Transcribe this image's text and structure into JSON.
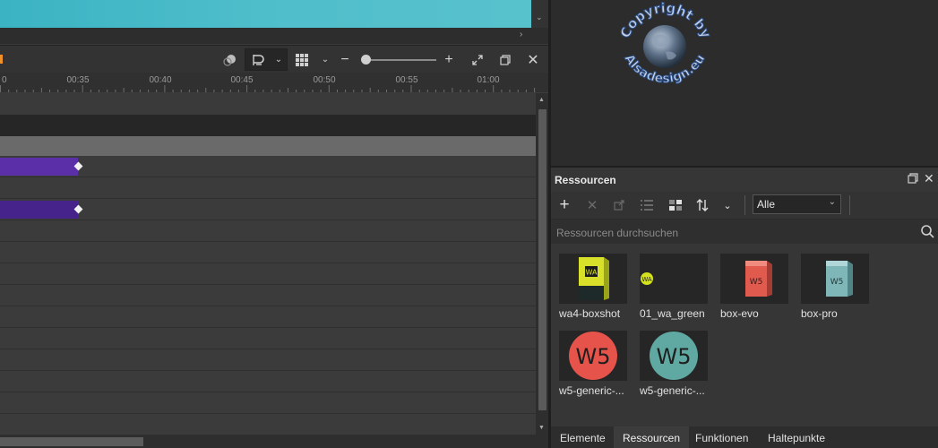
{
  "timeline": {
    "ruler_labels": [
      "0",
      "00:35",
      "00:40",
      "00:45",
      "00:50",
      "00:55",
      "01:00"
    ],
    "clip_color_1": "#5a2fa8",
    "clip_color_2": "#46238a",
    "accent_color": "#f0902a"
  },
  "watermark": {
    "line1": "Copyright by",
    "line2": "Alsadesign.eu"
  },
  "resources": {
    "title": "Ressourcen",
    "filter_value": "Alle",
    "search_placeholder": "Ressourcen durchsuchen",
    "items": [
      {
        "label": "wa4-boxshot",
        "icon": "wa4-boxshot-image"
      },
      {
        "label": "01_wa_green",
        "icon": "wa-green-logo-image"
      },
      {
        "label": "box-evo",
        "icon": "box-evo-image"
      },
      {
        "label": "box-pro",
        "icon": "box-pro-image"
      },
      {
        "label": "w5-generic-...",
        "icon": "w5-red-logo-image"
      },
      {
        "label": "w5-generic-...",
        "icon": "w5-teal-logo-image"
      }
    ]
  },
  "bottom_tabs": {
    "elemente": "Elemente",
    "ressourcen": "Ressourcen",
    "funktionen": "Funktionen",
    "haltepunkte": "Haltepunkte",
    "active": "Ressourcen"
  }
}
